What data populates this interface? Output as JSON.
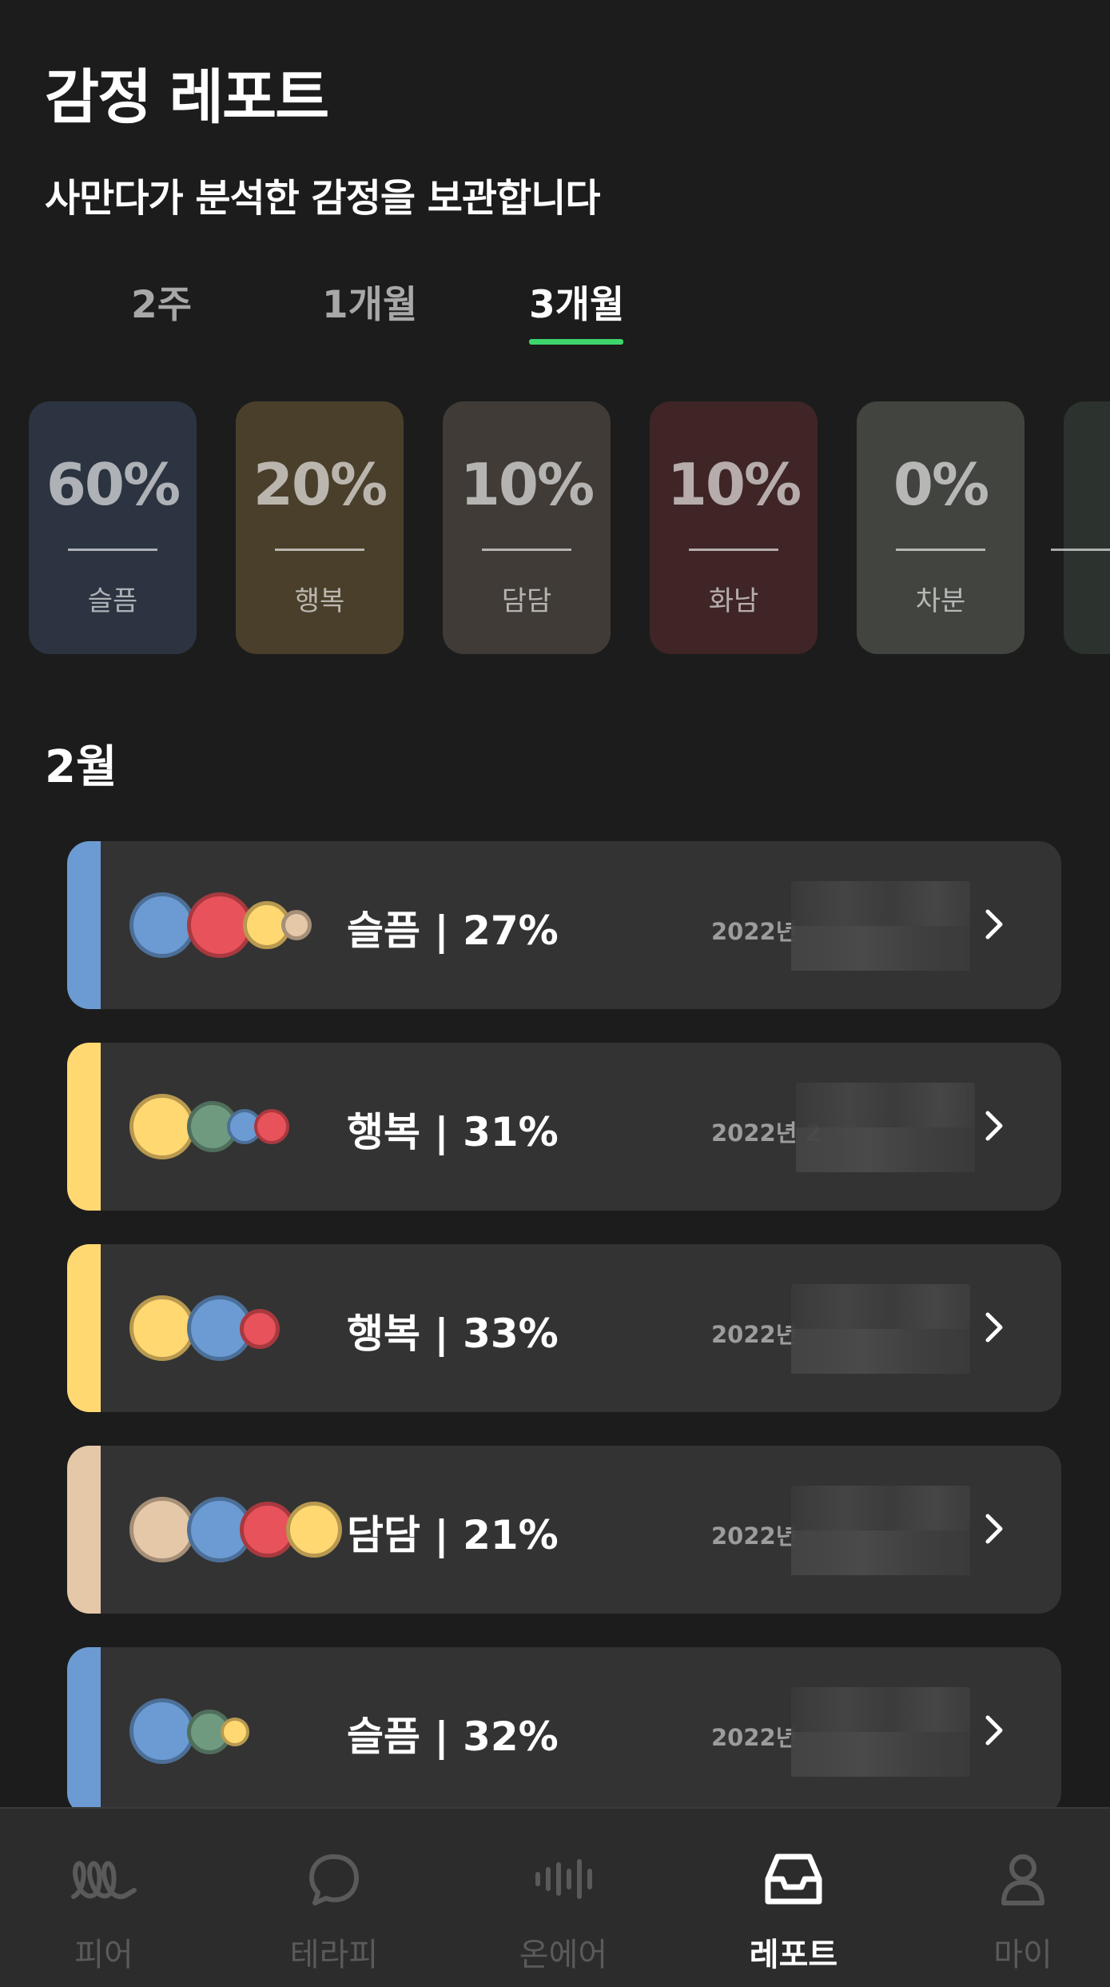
{
  "header": {
    "title": "감정 레포트",
    "subtitle": "사만다가 분석한 감정을 보관합니다"
  },
  "tabs": [
    "2주",
    "1개월",
    "3개월"
  ],
  "active_tab": "3개월",
  "accent_color": "#3ed66c",
  "emotion_cards": [
    {
      "percent": "60%",
      "label": "슬픔",
      "color": "#2b3440"
    },
    {
      "percent": "20%",
      "label": "행복",
      "color": "#4a3f2b"
    },
    {
      "percent": "10%",
      "label": "담담",
      "color": "#403b36"
    },
    {
      "percent": "10%",
      "label": "화남",
      "color": "#3f2526"
    },
    {
      "percent": "0%",
      "label": "차분",
      "color": "#42443f"
    }
  ],
  "month_label": "2월",
  "reports": [
    {
      "summary": "슬픔 | 27%",
      "date": "2022년 ",
      "accent": "#6b9bd2"
    },
    {
      "summary": "행복 | 31%",
      "date": "2022년 2",
      "accent": "#ffd872"
    },
    {
      "summary": "행복 | 33%",
      "date": "2022년 ",
      "accent": "#ffd872"
    },
    {
      "summary": "담담 | 21%",
      "date": "2022년 ",
      "accent": "#e5c8a8"
    },
    {
      "summary": "슬픔 | 32%",
      "date": "2022년 ",
      "accent": "#6b9bd2"
    }
  ],
  "bottom_nav": [
    {
      "label": "피어",
      "icon": "peer-icon"
    },
    {
      "label": "테라피",
      "icon": "chat-bubble-icon"
    },
    {
      "label": "온에어",
      "icon": "soundwave-icon"
    },
    {
      "label": "레포트",
      "icon": "inbox-icon"
    },
    {
      "label": "마이",
      "icon": "person-icon"
    }
  ],
  "active_nav": "레포트"
}
